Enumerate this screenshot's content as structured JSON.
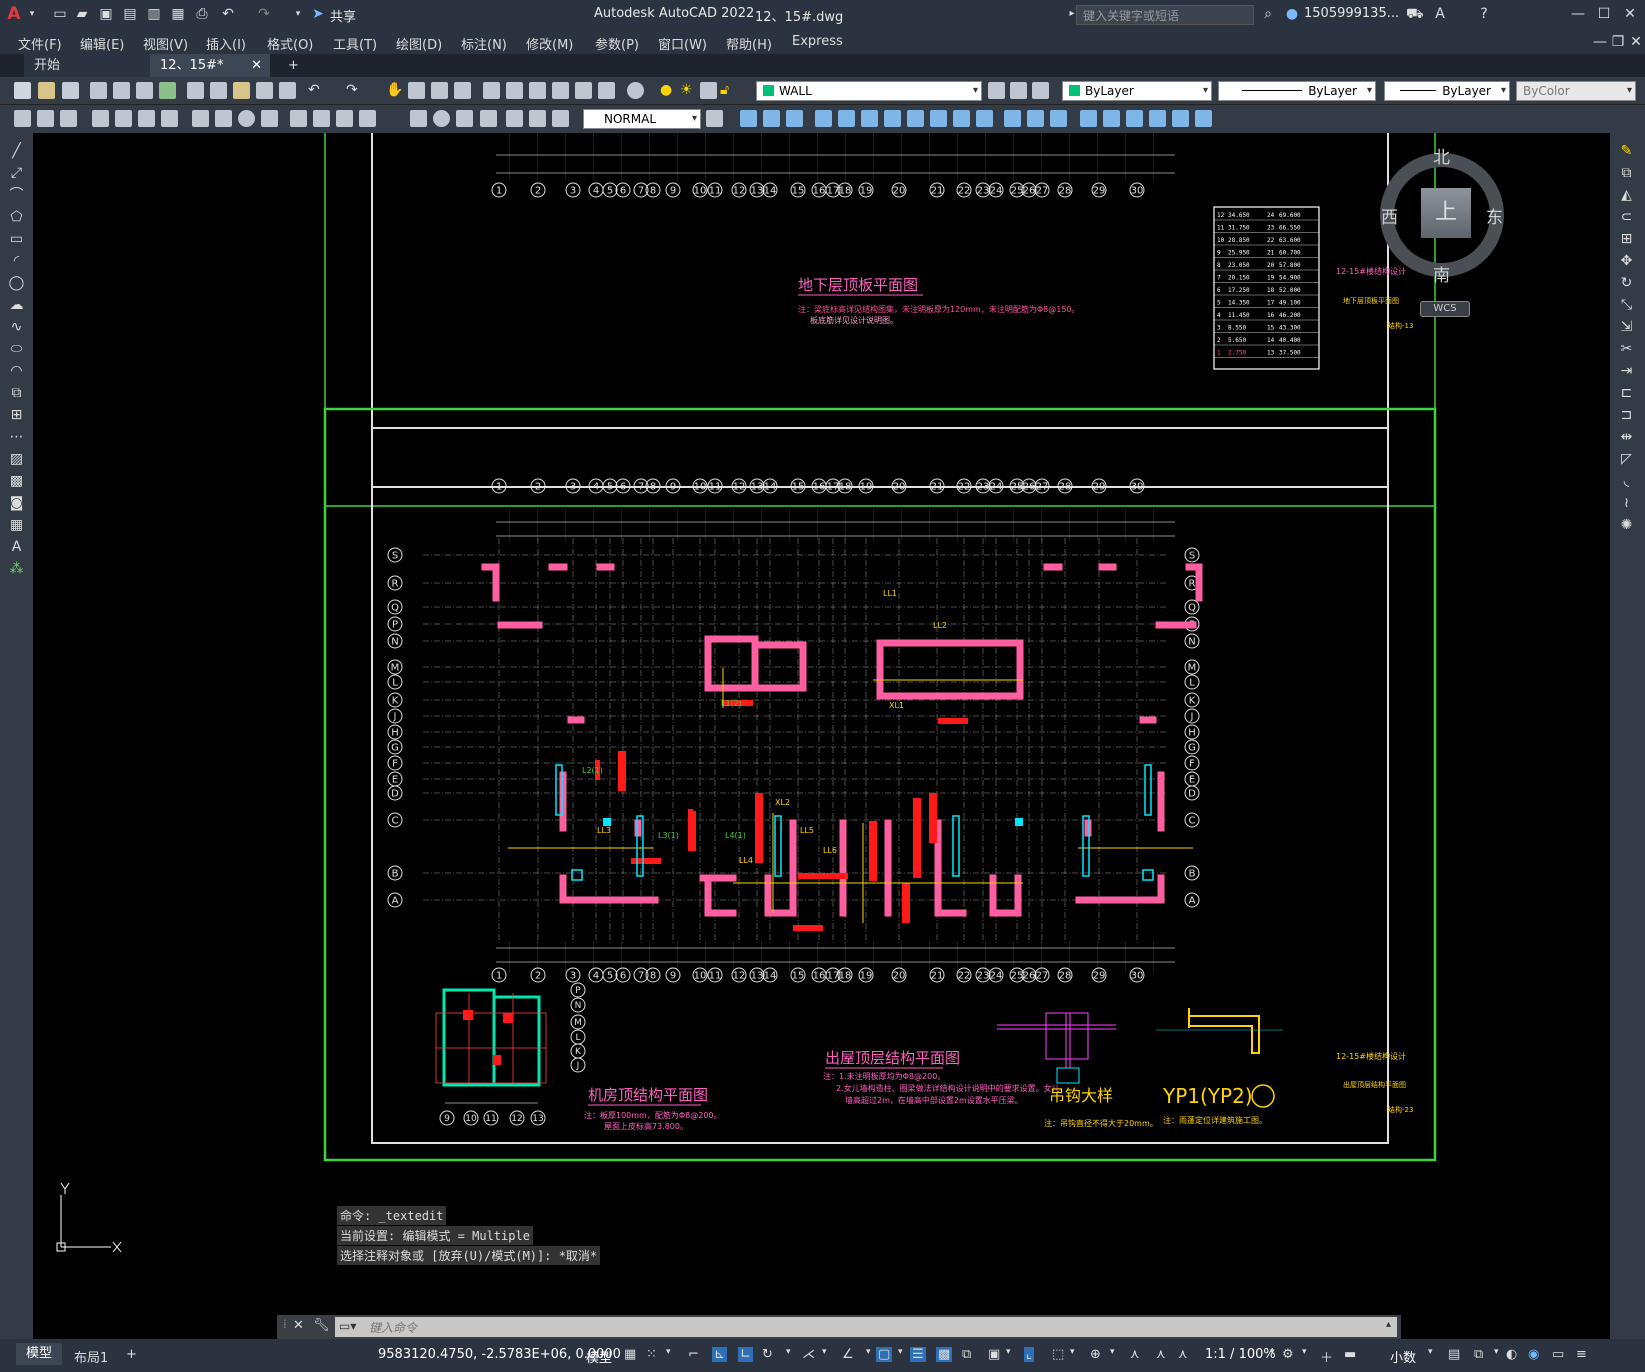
{
  "title": {
    "app": "Autodesk AutoCAD 2022",
    "file": "12、15#.dwg",
    "share": "共享",
    "search_placeholder": "键入关键字或短语",
    "user": "1505999135...",
    "window_controls": [
      "minimize-icon",
      "maximize-icon",
      "close-icon"
    ]
  },
  "menu": [
    "文件(F)",
    "编辑(E)",
    "视图(V)",
    "插入(I)",
    "格式(O)",
    "工具(T)",
    "绘图(D)",
    "标注(N)",
    "修改(M)",
    "参数(P)",
    "窗口(W)",
    "帮助(H)",
    "Express"
  ],
  "tabs": {
    "start": "开始",
    "doc": "12、15#*",
    "add": "+"
  },
  "toolbar1": {
    "layer": "WALL",
    "color": "ByLayer",
    "linetype": "ByLayer",
    "lineweight": "ByLayer",
    "plotstyle": "ByColor"
  },
  "toolbar2": {
    "dimstyle": "NORMAL"
  },
  "viewcube": {
    "north": "北",
    "south": "南",
    "east": "东",
    "west": "西",
    "top": "上",
    "wcs": "WCS"
  },
  "drawing": {
    "sheet1_title": "地下层顶板平面图",
    "sheet1_note1": "注：梁底标高详见结构图集，未注明板厚为120mm，未注明配筋为Φ8@150。",
    "sheet1_note2": "板底筋详见设计说明图。",
    "sheet1_project": "12-15#楼结构设计",
    "sheet1_dwgname": "地下层顶板平面图",
    "sheet1_dwgno": "结构-13",
    "sheet2_title": "出屋顶层结构平面图",
    "sheet2_note1": "注：1.未注明板厚均为Φ8@200。",
    "sheet2_note2": "2.女儿墙构造柱、圈梁做法详结构设计说明中的要求设置。女儿",
    "sheet2_note3": "墙高超过2m，在墙高中部设置2m设置水平压梁。",
    "machine_title": "机房顶结构平面图",
    "machine_note1": "注：板厚100mm，配筋为Φ8@200。",
    "machine_note2": "屋面上皮标高73.800。",
    "hook_title": "吊钩大样",
    "hook_note": "注：吊钩直径不得大于20mm。",
    "yp_title": "YP1(YP2)",
    "yp_note": "注：雨蓬定位详建筑施工图。",
    "sheet2_project": "12-15#楼结构设计",
    "sheet2_dwgname": "出屋顶层结构平面图",
    "sheet2_dwgno": "结构-23",
    "axis_cols": [
      "1",
      "2",
      "3",
      "4",
      "5",
      "6",
      "7",
      "8",
      "9",
      "10",
      "11",
      "12",
      "13",
      "14",
      "15",
      "16",
      "17",
      "18",
      "19",
      "20",
      "21",
      "22",
      "23",
      "24",
      "25",
      "26",
      "27",
      "28",
      "29",
      "30"
    ],
    "axis_rows": [
      "S",
      "R",
      "Q",
      "P",
      "N",
      "M",
      "L",
      "K",
      "J",
      "H",
      "G",
      "F",
      "E",
      "D",
      "C",
      "B",
      "A"
    ],
    "machine_cols": [
      "9",
      "10",
      "11",
      "12",
      "13"
    ],
    "machine_rows": [
      "P",
      "N",
      "M",
      "L",
      "K",
      "J"
    ],
    "elevation_table": [
      [
        "12",
        "34.650",
        "24",
        "69.600"
      ],
      [
        "11",
        "31.750",
        "23",
        "66.550"
      ],
      [
        "10",
        "28.850",
        "22",
        "63.600"
      ],
      [
        "9",
        "25.950",
        "21",
        "60.700"
      ],
      [
        "8",
        "23.050",
        "20",
        "57.800"
      ],
      [
        "7",
        "20.150",
        "19",
        "54.900"
      ],
      [
        "6",
        "17.250",
        "18",
        "52.000"
      ],
      [
        "5",
        "14.350",
        "17",
        "49.100"
      ],
      [
        "4",
        "11.450",
        "16",
        "46.200"
      ],
      [
        "3",
        "8.550",
        "15",
        "43.300"
      ],
      [
        "2",
        "5.650",
        "14",
        "40.400"
      ],
      [
        "1",
        "2.750",
        "13",
        "37.500"
      ]
    ],
    "beam_labels": [
      "LL1",
      "LL2",
      "LL3",
      "LL4",
      "LL5",
      "LL6",
      "L1(2)",
      "XL1",
      "XL2",
      "L2(1)",
      "L3(1)",
      "L4(1)"
    ],
    "ucs_y": "Y",
    "ucs_x": "X"
  },
  "command": {
    "history": [
      "命令: _textedit",
      "当前设置: 编辑模式 = Multiple",
      "选择注释对象或 [放弃(U)/模式(M)]: *取消*"
    ],
    "placeholder": "键入命令"
  },
  "status": {
    "model_tab": "模型",
    "layout_tab": "布局1",
    "add": "+",
    "coords": "9583120.4750, -2.5783E+06, 0.0000",
    "model": "模型",
    "scale": "1:1 / 100%",
    "units": "小数"
  }
}
